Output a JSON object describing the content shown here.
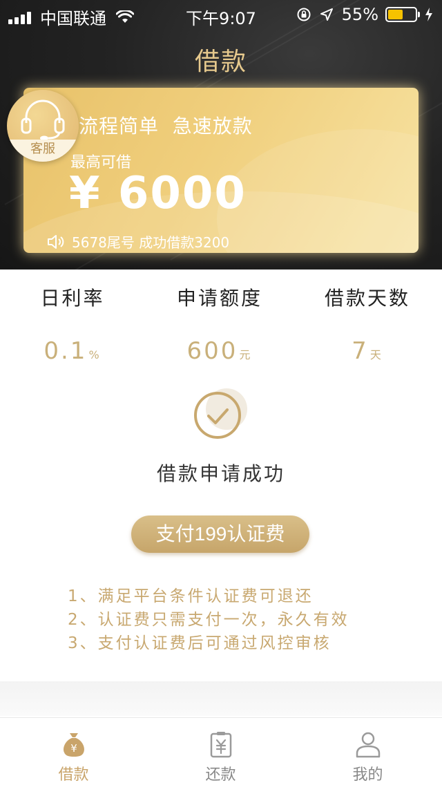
{
  "status_bar": {
    "carrier": "中国联通",
    "time": "下午9:07",
    "battery_percent": "55%",
    "battery_level": 0.55,
    "icons": [
      "signal-icon",
      "wifi-icon",
      "rotation-lock-icon",
      "location-icon",
      "battery-icon",
      "charging-icon"
    ]
  },
  "header": {
    "title": "借款"
  },
  "card": {
    "slogan": "流程简单  急速放款",
    "max_label": "最高可借",
    "amount": "¥ 6000",
    "notice": "5678尾号 成功借款3200"
  },
  "customer_service": {
    "label": "客服"
  },
  "stats": [
    {
      "label": "日利率",
      "value": "0.1",
      "unit": "%"
    },
    {
      "label": "申请额度",
      "value": "600",
      "unit": "元"
    },
    {
      "label": "借款天数",
      "value": "7",
      "unit": "天"
    }
  ],
  "result": {
    "message": "借款申请成功",
    "pay_button": "支付199认证费"
  },
  "notes": [
    "1、满足平台条件认证费可退还",
    "2、认证费只需支付一次，永久有效",
    "3、支付认证费后可通过风控审核"
  ],
  "tab_bar": {
    "tabs": [
      {
        "label": "借款",
        "active": true
      },
      {
        "label": "还款",
        "active": false
      },
      {
        "label": "我的",
        "active": false
      }
    ]
  },
  "colors": {
    "accent_gold": "#c9a46a",
    "title_gold": "#e6c98d",
    "inactive_gray": "#999999"
  }
}
